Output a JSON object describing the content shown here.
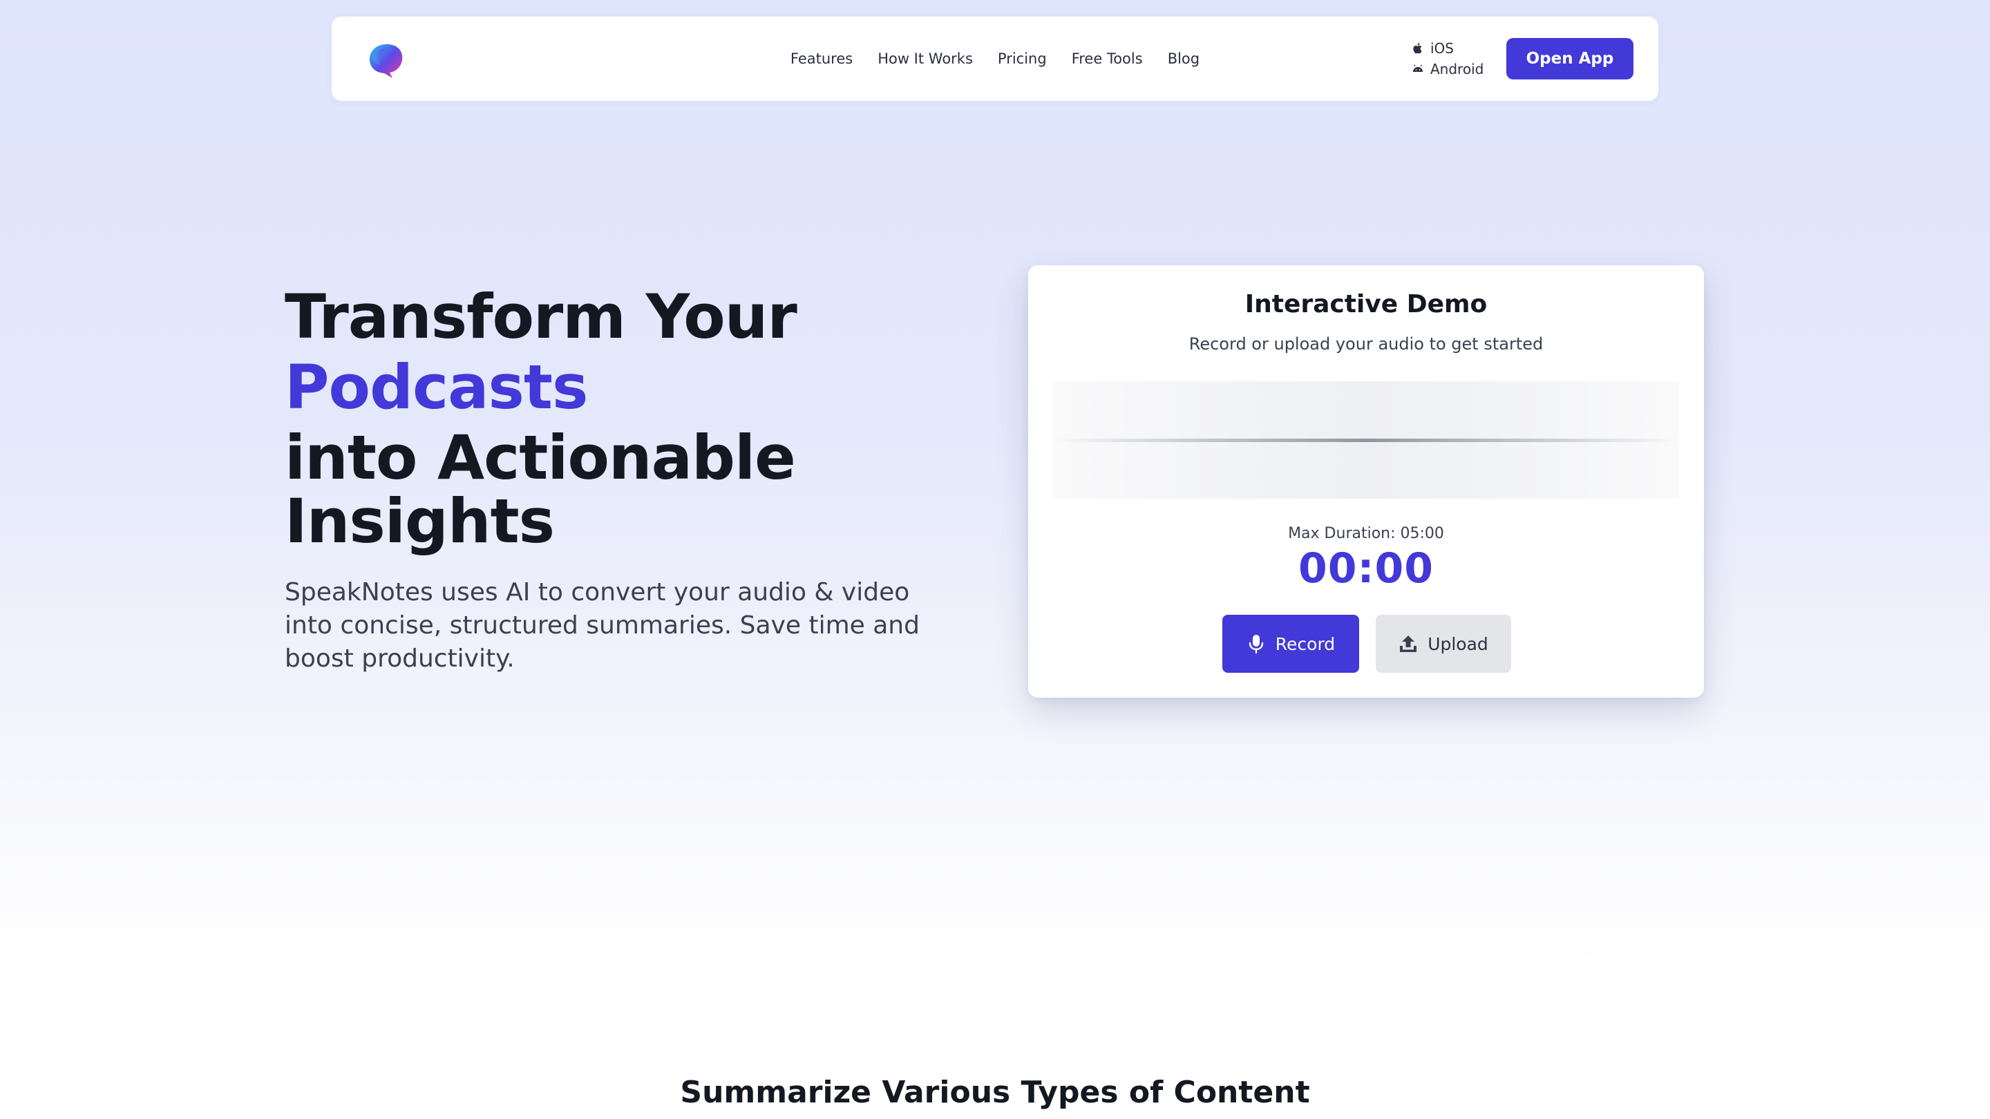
{
  "nav": {
    "logo_icon": "speaknotes-logo-icon",
    "links": [
      "Features",
      "How It Works",
      "Pricing",
      "Free Tools",
      "Blog"
    ],
    "stores": {
      "ios": "iOS",
      "android": "Android"
    },
    "open_app_label": "Open App"
  },
  "hero": {
    "title_line1": "Transform Your",
    "title_accent": "Podcasts",
    "title_line3": "into Actionable",
    "title_line4": "Insights",
    "subtitle": "SpeakNotes uses AI to convert your audio & video into concise, structured summaries. Save time and boost productivity."
  },
  "demo": {
    "title": "Interactive Demo",
    "subtitle": "Record or upload your audio to get started",
    "max_duration": "Max Duration: 05:00",
    "timer": "00:00",
    "record_label": "Record",
    "upload_label": "Upload"
  },
  "section": {
    "title": "Summarize Various Types of Content"
  },
  "colors": {
    "accent": "#4338d8",
    "text": "#141821",
    "muted": "#3a4050"
  }
}
